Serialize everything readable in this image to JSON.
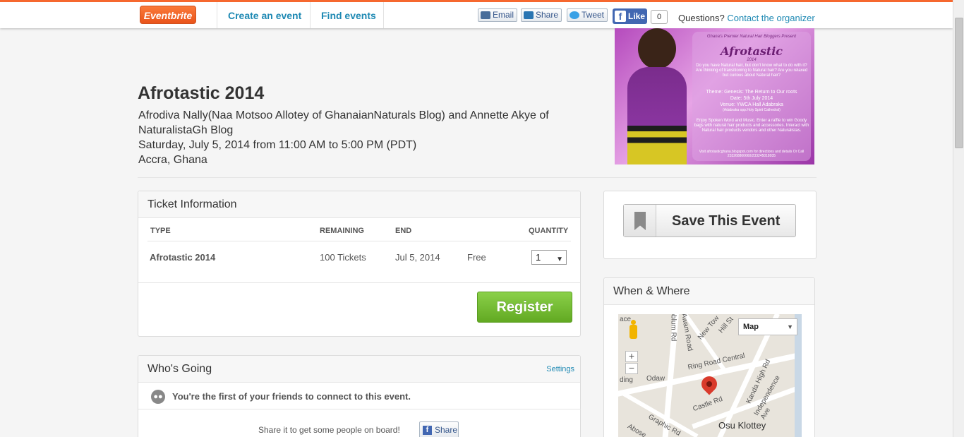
{
  "header": {
    "logo": "Eventbrite",
    "nav": [
      "Create an event",
      "Find events"
    ],
    "share_buttons": [
      "Email",
      "Share",
      "Tweet"
    ],
    "fb_like": "Like",
    "fb_like_count": "0",
    "questions_label": "Questions?",
    "contact_link": "Contact the organizer"
  },
  "event": {
    "title": "Afrotastic 2014",
    "organizer": "Afrodiva Nally(Naa Motsoo Allotey of GhanaianNaturals Blog) and Annette Akye of NaturalistaGh Blog",
    "datetime": "Saturday, July 5, 2014 from 11:00 AM to 5:00 PM (PDT)",
    "location": "Accra, Ghana"
  },
  "poster": {
    "kicker": "Ghana's Premier Natural Hair Bloggers Present",
    "title": "Afrotastic",
    "year": "2014",
    "intro": "Do you have Natural hair, but don't know what to do with it? Are thinking of transitioning to Natural hair? Are you relaxed but curious about Natural hair?",
    "theme": "Theme: Genesis: The Return to Our roots",
    "date": "Date: 5th July 2014",
    "venue": "Venue: YWCA Hall Adabraka",
    "venue_note": "(Adabraka opp.Holy Spirit Cathedral)",
    "details": "Enjoy Spoken Word and Music. Enter a raffle to win Goody bags with natural hair products and accessories. Interact with Natural hair products vendors and other Naturalistas.",
    "footer": "Visit afrotasticghana.blogspot.com for directions and details Or Call 233268800660/233245018935"
  },
  "tickets": {
    "heading": "Ticket Information",
    "columns": [
      "TYPE",
      "REMAINING",
      "END",
      "QUANTITY"
    ],
    "rows": [
      {
        "type": "Afrotastic 2014",
        "remaining": "100 Tickets",
        "end": "Jul 5, 2014",
        "price": "Free",
        "quantity": "1"
      }
    ],
    "register_label": "Register"
  },
  "save_event": {
    "label": "Save This Event"
  },
  "when_where": {
    "heading": "When & Where",
    "map_type": "Map",
    "zoom_in": "+",
    "zoom_out": "−",
    "labels": [
      "Ring Road Central",
      "Odaw",
      "Castle Rd",
      "Osu Klottey",
      "Graphic Rd",
      "Independence Ave",
      "Kanda High Rd",
      "New Tow",
      "Hill St",
      "Awam Road",
      "Ibblum Rd",
      "Abose",
      "ding",
      "ace"
    ]
  },
  "whos_going": {
    "heading": "Who's Going",
    "settings_label": "Settings",
    "friends_text": "You're the first of your friends to connect to this event.",
    "share_prompt": "Share it to get some people on board!",
    "share_button": "Share"
  }
}
